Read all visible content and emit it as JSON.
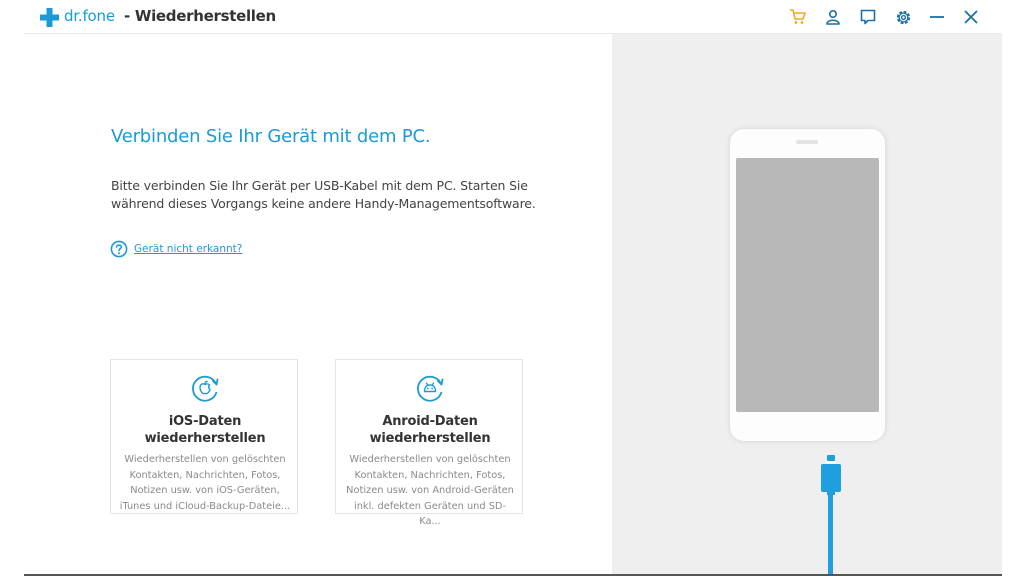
{
  "app": {
    "brand": "dr.fone",
    "window_title": "- Wiederherstellen",
    "brand_color": "#1a9bd7",
    "cart_color": "#f5a623"
  },
  "toolbar": {
    "icons": [
      "cart-icon",
      "user-icon",
      "feedback-icon",
      "settings-icon",
      "minimize-icon",
      "close-icon"
    ]
  },
  "main": {
    "heading": "Verbinden Sie Ihr Gerät mit dem PC.",
    "description": "Bitte verbinden Sie Ihr Gerät per USB-Kabel mit dem PC. Starten Sie während dieses Vorgangs keine andere Handy-Managementsoftware.",
    "help_link": "Gerät nicht erkannt?"
  },
  "cards": [
    {
      "title_line1": "iOS-Daten",
      "title_line2": "wiederherstellen",
      "description": "Wiederherstellen von gelöschten\nKontakten, Nachrichten, Fotos,\nNotizen usw. von iOS-Geräten,\niTunes und iCloud-Backup-Dateie...",
      "icon": "apple-restore-icon"
    },
    {
      "title_line1": "Anroid-Daten",
      "title_line2": "wiederherstellen",
      "description": "Wiederherstellen von gelöschten\nKontakten, Nachrichten, Fotos,\nNotizen usw. von Android-Geräten\ninkl. defekten Geräten und SD-Ka...",
      "icon": "android-restore-icon"
    }
  ]
}
